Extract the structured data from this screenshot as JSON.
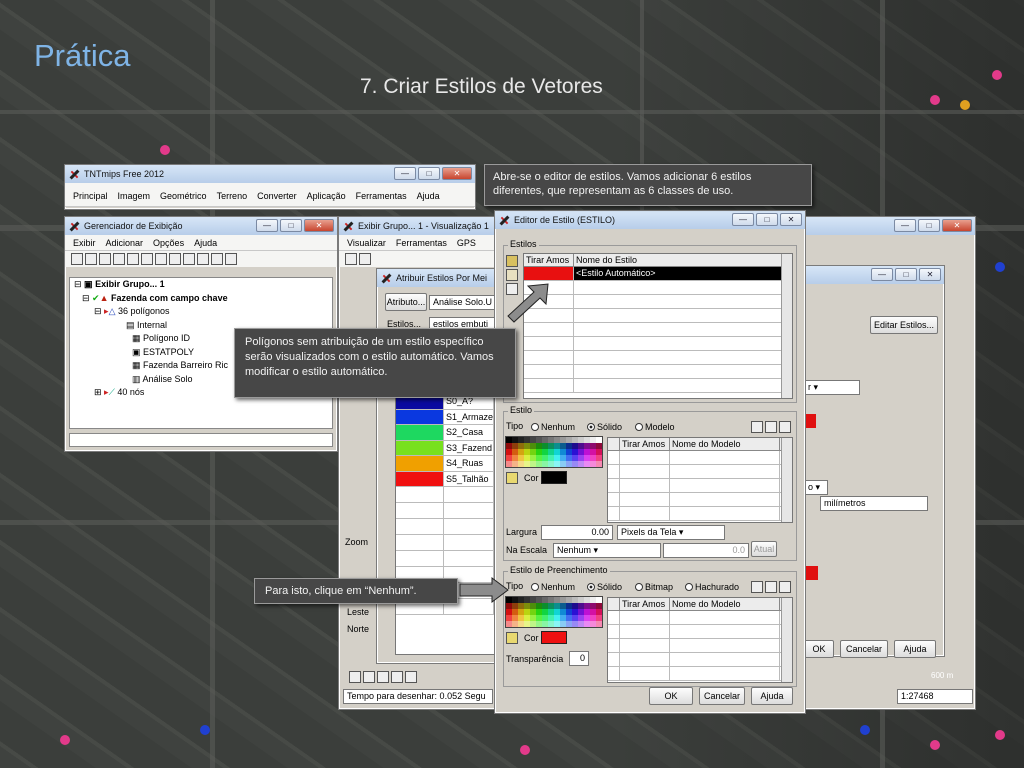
{
  "slide": {
    "title": "Prática",
    "subtitle": "7. Criar Estilos de Vetores"
  },
  "callouts": {
    "top": "Abre-se o editor de estilos. Vamos adicionar 6 estilos diferentes, que representam as 6 classes de uso.",
    "left": "Polígonos sem atribuição de um estilo específico serão visualizados com o estilo automático. Vamos modificar o estilo automático.",
    "bottom": "Para isto, clique em “Nenhum”."
  },
  "tntmips": {
    "title": "TNTmips Free 2012",
    "menu": [
      "Principal",
      "Imagem",
      "Geométrico",
      "Terreno",
      "Converter",
      "Aplicação",
      "Ferramentas",
      "Ajuda"
    ]
  },
  "gerenciador": {
    "title": "Gerenciador de Exibição",
    "menu": [
      "Exibir",
      "Adicionar",
      "Opções",
      "Ajuda"
    ],
    "tree": [
      "Exibir Grupo... 1",
      "Fazenda com campo chave",
      "36 polígonos",
      "Internal",
      "Polígono ID",
      "ESTATPOLY",
      "Fazenda Barreiro Ric",
      "Análise Solo",
      "40 nós"
    ]
  },
  "grupo": {
    "title": "Exibir Grupo... 1 - Visualização 1",
    "menu": [
      "Visualizar",
      "Ferramentas",
      "GPS"
    ],
    "side_labels": [
      "Zoom",
      "Leste",
      "Norte"
    ],
    "status": "Tempo para desenhar: 0.052 Segu"
  },
  "atribuir": {
    "title": "Atribuir Estilos Por Mei",
    "atributo_btn": "Atributo...",
    "atributo_val": "Análise Solo.U",
    "estilos_lbl": "Estilos...",
    "estilos_val": "estilos embuti",
    "rows": [
      {
        "label": "S0_A?",
        "color": "#0a0aa0"
      },
      {
        "label": "S1_Armaze",
        "color": "#0a38e0"
      },
      {
        "label": "S2_Casa",
        "color": "#1ed860"
      },
      {
        "label": "S3_Fazend",
        "color": "#78e01e"
      },
      {
        "label": "S4_Ruas",
        "color": "#f0a000"
      },
      {
        "label": "S5_Talhão",
        "color": "#f01010"
      }
    ]
  },
  "rightwin": {
    "editar": "Editar Estilos...",
    "milimetros": "milímetros",
    "ok": "OK",
    "cancelar": "Cancelar",
    "ajuda": "Ajuda",
    "scale": "1:27468",
    "scalebar": "600 m"
  },
  "editor": {
    "title": "Editor de Estilo (ESTILO)",
    "estilos_group": "Estilos",
    "col1": "Tirar Amos",
    "col2": "Nome do Estilo",
    "row1": "<Estilo Automático>",
    "estilo_group": "Estilo",
    "tipo": "Tipo",
    "nenhum": "Nenhum",
    "solido": "Sólido",
    "modelo": "Modelo",
    "col_tirar": "Tirar Amos",
    "col_modelo": "Nome do Modelo",
    "cor": "Cor",
    "largura": "Largura",
    "largura_val": "0.00",
    "pixels": "Pixels da Tela",
    "na_escala": "Na Escala",
    "nenhum_sel": "Nenhum",
    "escala_val": "0.0",
    "atual": "Atual",
    "preench_group": "Estilo de Preenchimento",
    "bitmap": "Bitmap",
    "hachurado": "Hachurado",
    "transparencia": "Transparência",
    "transp_val": "0",
    "ok": "OK",
    "cancelar": "Cancelar",
    "ajuda": "Ajuda"
  },
  "colors": {
    "accent": "#7fb4e6",
    "line_color": "#000000",
    "fill_color": "#ee1111",
    "auto_style": "#ee1111"
  }
}
